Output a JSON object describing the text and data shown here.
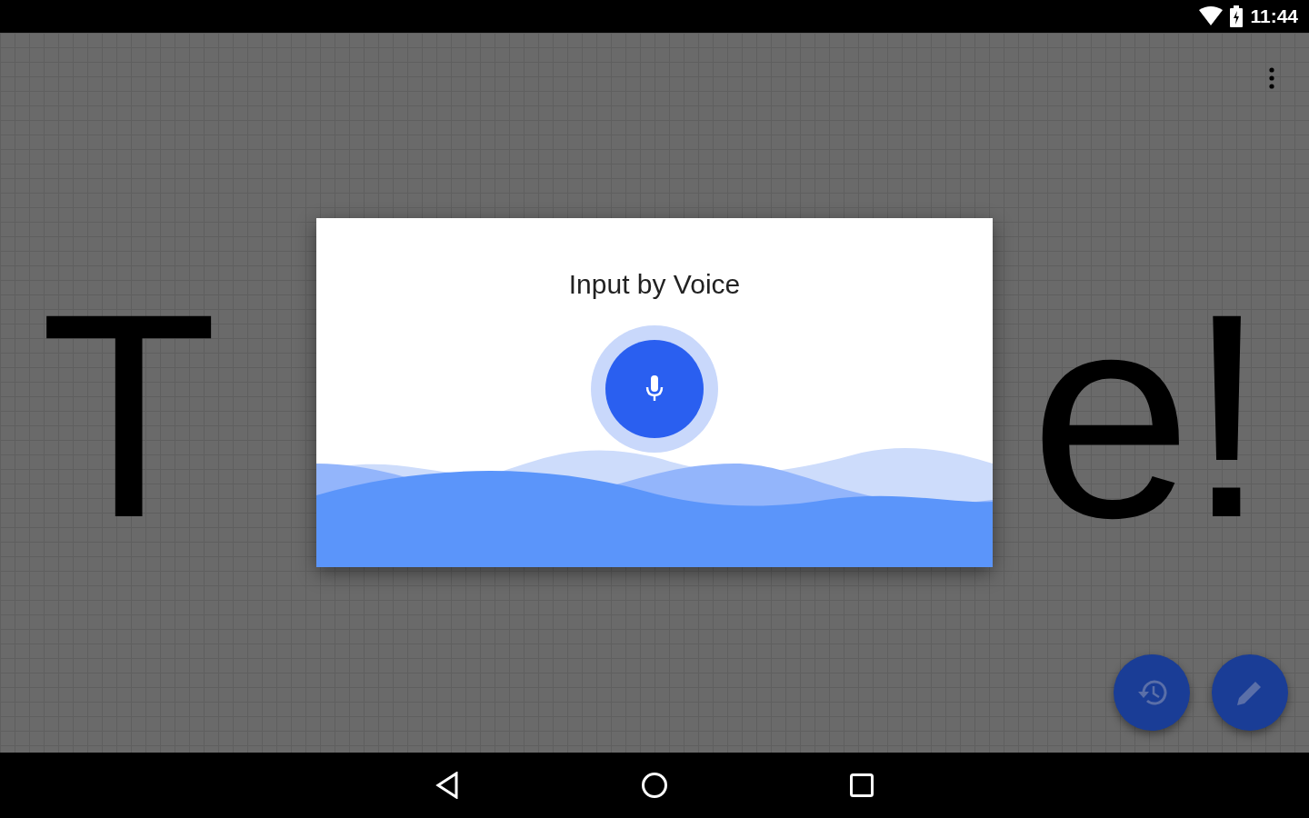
{
  "status_bar": {
    "time": "11:44"
  },
  "background_text": {
    "left": "T",
    "right": "e!"
  },
  "dialog": {
    "title": "Input by Voice"
  }
}
